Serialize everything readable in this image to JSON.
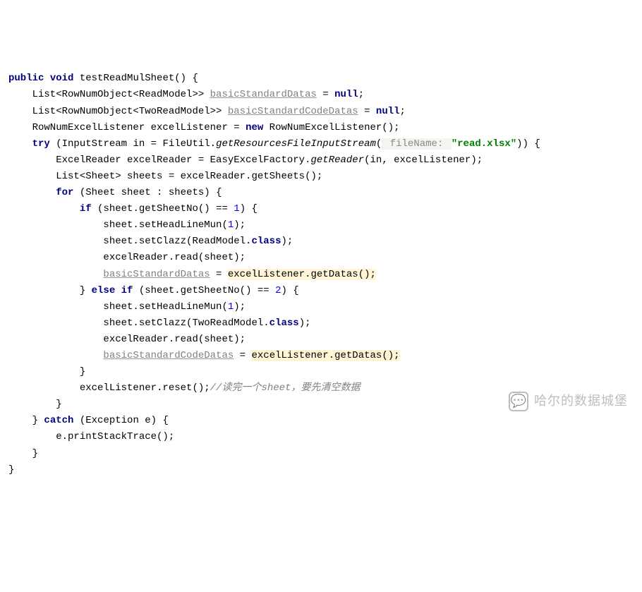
{
  "code": {
    "line1": {
      "kw1": "public",
      "kw2": "void",
      "method": "testReadMulSheet",
      "paren": "() {"
    },
    "line2": {
      "pre": "    List<RowNumObject<ReadModel>> ",
      "var": "basicStandardDatas",
      "post": " = ",
      "kw": "null",
      "semi": ";"
    },
    "line3": {
      "pre": "    List<RowNumObject<TwoReadModel>> ",
      "var": "basicStandardCodeDatas",
      "post": " = ",
      "kw": "null",
      "semi": ";"
    },
    "line4": {
      "pre": "    RowNumExcelListener excelListener = ",
      "kw": "new",
      "post": " RowNumExcelListener();"
    },
    "line5": {
      "kw": "try",
      "pre": " (InputStream in = FileUtil.",
      "ital": "getResourcesFileInputStream",
      "open": "(",
      "hint": " fileName: ",
      "str": "\"read.xlsx\"",
      "close": ")) {"
    },
    "line6": {
      "text": "        ExcelReader excelReader = EasyExcelFactory.",
      "ital": "getReader",
      "post": "(in, excelListener);"
    },
    "line7": {
      "text": "        List<Sheet> sheets = excelReader.getSheets();"
    },
    "line8": {
      "pre": "        ",
      "kw": "for",
      "mid": " (Sheet sheet : sheets) {"
    },
    "line9": {
      "pre": "            ",
      "kw": "if",
      "mid": " (sheet.getSheetNo() == ",
      "num": "1",
      "post": ") {"
    },
    "line10": {
      "pre": "                sheet.setHeadLineMun(",
      "num": "1",
      "post": ");"
    },
    "line11": {
      "pre": "                sheet.setClazz(ReadModel.",
      "kw": "class",
      "post": ");"
    },
    "line12": {
      "text": "                excelReader.read(sheet);"
    },
    "line13": {
      "pre": "                ",
      "var": "basicStandardDatas",
      "eq": " = ",
      "hl": "excelListener.getDatas();"
    },
    "line14": {
      "pre": "            } ",
      "kw1": "else",
      "sp": " ",
      "kw2": "if",
      "mid": " (sheet.getSheetNo() == ",
      "num": "2",
      "post": ") {"
    },
    "line15": {
      "pre": "                sheet.setHeadLineMun(",
      "num": "1",
      "post": ");"
    },
    "line16": {
      "pre": "                sheet.setClazz(TwoReadModel.",
      "kw": "class",
      "post": ");"
    },
    "line17": {
      "text": "                excelReader.read(sheet);"
    },
    "line18": {
      "pre": "                ",
      "var": "basicStandardCodeDatas",
      "eq": " = ",
      "hl": "excelListener.getDatas();"
    },
    "line19": {
      "text": "            }"
    },
    "line20": {
      "text": "            excelListener.reset();",
      "comment": "//读完一个sheet，要先清空数据"
    },
    "line21": {
      "text": "        }"
    },
    "line22": {
      "pre": "    } ",
      "kw": "catch",
      "post": " (Exception e) {"
    },
    "line23": {
      "text": "        e.printStackTrace();"
    },
    "line24": {
      "text": "    }"
    },
    "line25": {
      "text": "}"
    }
  },
  "watermark": {
    "icon": "💬",
    "text": "哈尔的数据城堡"
  }
}
